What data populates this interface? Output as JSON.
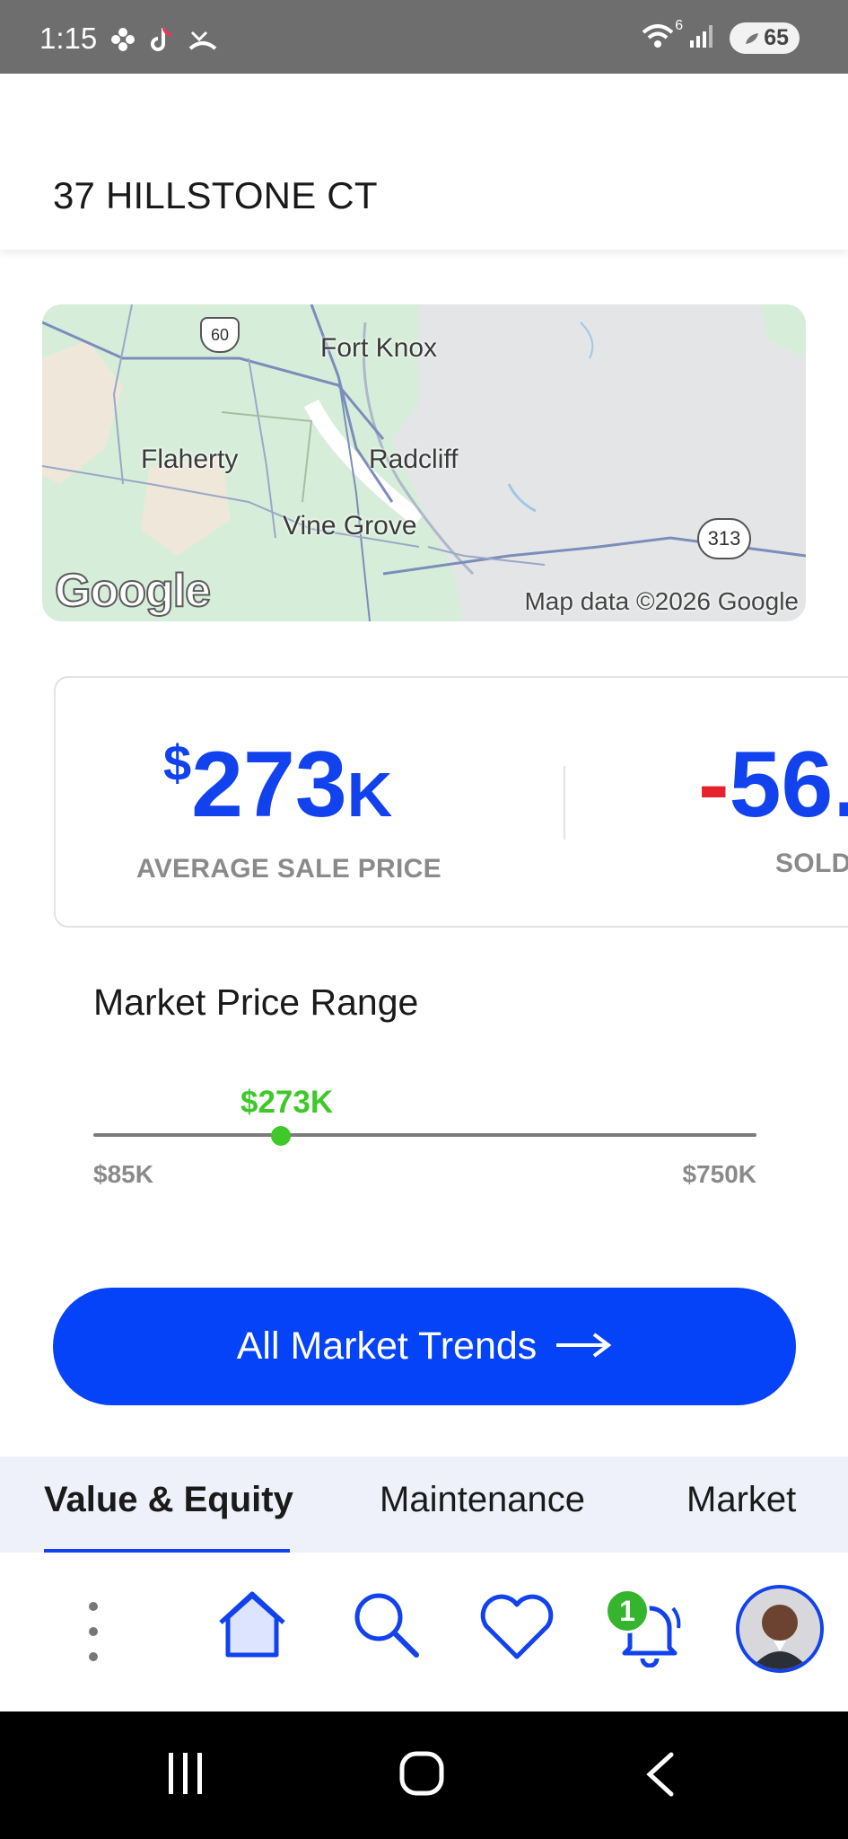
{
  "status_bar": {
    "time": "1:15",
    "wifi_label": "6",
    "battery": "65",
    "icons_left": [
      "flower-icon",
      "tiktok-icon",
      "missed-call-icon"
    ],
    "icons_right": [
      "wifi-icon",
      "signal-icon",
      "battery-icon"
    ]
  },
  "header": {
    "address": "37 HILLSTONE CT"
  },
  "map": {
    "labels": [
      "Fort Knox",
      "Flaherty",
      "Radcliff",
      "Vine Grove"
    ],
    "shields": [
      "60",
      "313"
    ],
    "logo": "Google",
    "credit": "Map data ©2026 Google"
  },
  "stats": {
    "avg_currency": "$",
    "avg_value": "273",
    "avg_unit": "K",
    "avg_label": "AVERAGE SALE PRICE",
    "sold_sign": "-",
    "sold_value": "56.",
    "sold_label": "SOLD"
  },
  "price_range": {
    "title": "Market Price Range",
    "current": "$273K",
    "min": "$85K",
    "max": "$750K",
    "position_fraction": 0.283
  },
  "cta": {
    "label": "All Market Trends"
  },
  "tabs": {
    "items": [
      {
        "label": "Value & Equity",
        "active": true
      },
      {
        "label": "Maintenance",
        "active": false
      },
      {
        "label": "Market",
        "active": false
      }
    ]
  },
  "bottom_nav": {
    "items": [
      "more-icon",
      "home-icon",
      "search-icon",
      "heart-icon",
      "bell-icon",
      "avatar"
    ],
    "notification_count": "1"
  },
  "colors": {
    "primary": "#1142ee",
    "cta": "#0443f8",
    "accent_green": "#3ec929",
    "negative_red": "#e5222e",
    "status_bar": "#6e6e6e"
  }
}
